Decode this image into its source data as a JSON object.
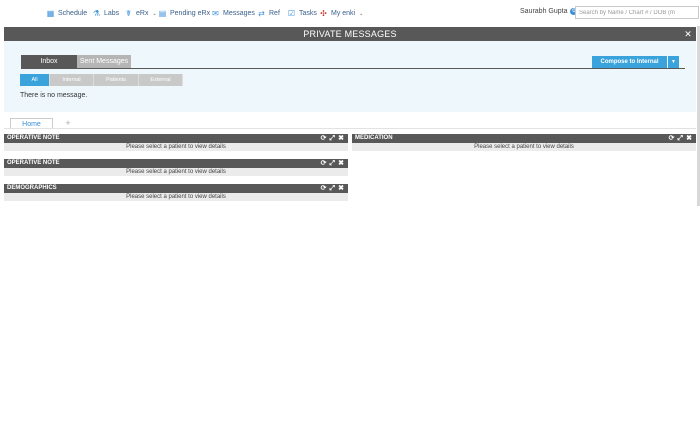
{
  "nav": {
    "items": [
      {
        "label": "Schedule",
        "icon": "calendar-icon",
        "glyph": "▦"
      },
      {
        "label": "Labs",
        "icon": "flask-icon",
        "glyph": "⚗"
      },
      {
        "label": "eRx",
        "icon": "rx-icon",
        "glyph": "☤",
        "has_caret": true
      },
      {
        "label": "Pending eRx",
        "icon": "document-icon",
        "glyph": "▤"
      },
      {
        "label": "Messages",
        "icon": "envelope-icon",
        "glyph": "✉"
      },
      {
        "label": "Ref",
        "icon": "referral-icon",
        "glyph": "⇄"
      },
      {
        "label": "Tasks",
        "icon": "checklist-icon",
        "glyph": "☑"
      },
      {
        "label": "My enki",
        "icon": "enki-icon",
        "glyph": "✣",
        "has_caret": true
      }
    ],
    "caret": "⌄",
    "user_name": "Saurabh Gupta",
    "search_placeholder": "Search by Name / Chart # / DOB (m"
  },
  "private_messages": {
    "title": "PRIVATE MESSAGES",
    "close": "✕",
    "tabs": [
      "Inbox",
      "Sent Messages"
    ],
    "compose_label": "Compose to Internal",
    "compose_dropdown": "▼",
    "filters": [
      "All",
      "Internal",
      "Patients",
      "External"
    ],
    "empty_text": "There is no message."
  },
  "home_tab": {
    "label": "Home",
    "add": "+"
  },
  "widget_icons": {
    "refresh": "⟳",
    "expand": "⤢",
    "close": "✖"
  },
  "widgets": [
    {
      "title": "OPERATIVE NOTE",
      "body": "Please select a patient to view details"
    },
    {
      "title": "MEDICATION",
      "body": "Please select a patient to view details"
    },
    {
      "title": "OPERATIVE NOTE",
      "body": "Please select a patient to view details"
    },
    {
      "title": "DEMOGRAPHICS",
      "body": "Please select a patient to view details"
    }
  ],
  "colors": {
    "accent": "#3ba3dc",
    "header_dark": "#585858",
    "panel_bg": "#eef7fc"
  }
}
